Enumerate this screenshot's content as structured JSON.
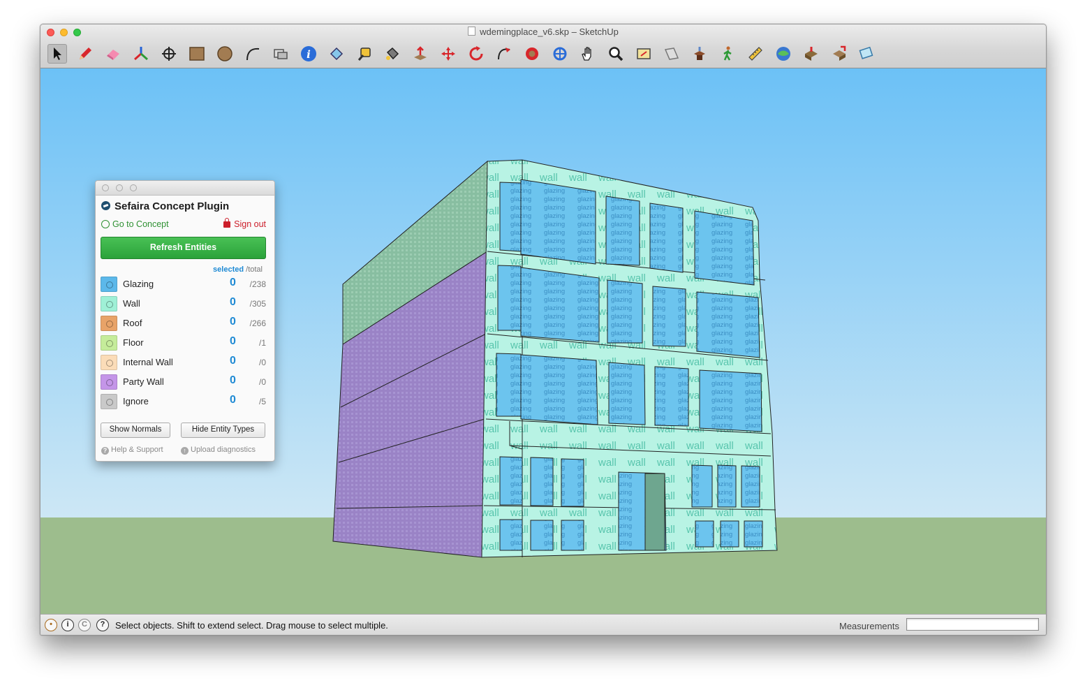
{
  "window": {
    "title": "wdemingplace_v6.skp – SketchUp"
  },
  "toolbar": {
    "tools": [
      {
        "name": "select-tool",
        "icon": "arrow-icon"
      },
      {
        "name": "line-tool",
        "icon": "pencil-icon"
      },
      {
        "name": "eraser-tool",
        "icon": "eraser-icon"
      },
      {
        "name": "axes-tool",
        "icon": "axes-icon"
      },
      {
        "name": "position-camera-tool",
        "icon": "crosshair-icon"
      },
      {
        "name": "rectangle-tool",
        "icon": "rectangle-icon"
      },
      {
        "name": "circle-tool",
        "icon": "circle-icon"
      },
      {
        "name": "arc-tool",
        "icon": "arc-icon"
      },
      {
        "name": "section-plane-tool",
        "icon": "section-icon"
      },
      {
        "name": "model-info-tool",
        "icon": "info-icon"
      },
      {
        "name": "paint-tool",
        "icon": "paint-bucket-icon"
      },
      {
        "name": "tape-measure-tool",
        "icon": "tape-measure-icon"
      },
      {
        "name": "paint-bucket-tool",
        "icon": "bucket-icon"
      },
      {
        "name": "push-pull-tool",
        "icon": "push-pull-icon"
      },
      {
        "name": "move-tool",
        "icon": "move-icon"
      },
      {
        "name": "rotate-tool",
        "icon": "rotate-icon"
      },
      {
        "name": "follow-me-tool",
        "icon": "follow-me-icon"
      },
      {
        "name": "offset-tool",
        "icon": "offset-icon"
      },
      {
        "name": "orbit-tool",
        "icon": "orbit-icon"
      },
      {
        "name": "pan-tool",
        "icon": "hand-icon"
      },
      {
        "name": "zoom-tool",
        "icon": "magnifier-icon"
      },
      {
        "name": "zoom-extents-tool",
        "icon": "zoom-extents-icon"
      },
      {
        "name": "previous-view-tool",
        "icon": "previous-view-icon"
      },
      {
        "name": "get-models-tool",
        "icon": "get-models-icon"
      },
      {
        "name": "walk-tool",
        "icon": "walk-icon"
      },
      {
        "name": "dimension-tool",
        "icon": "ruler-icon"
      },
      {
        "name": "geo-location-tool",
        "icon": "globe-icon"
      },
      {
        "name": "share-model-tool",
        "icon": "share-model-icon"
      },
      {
        "name": "share-component-tool",
        "icon": "share-component-icon"
      },
      {
        "name": "layout-tool",
        "icon": "layout-icon"
      }
    ]
  },
  "plugin": {
    "title": "Sefaira Concept Plugin",
    "goto_label": "Go to Concept",
    "signout_label": "Sign out",
    "refresh_label": "Refresh Entities",
    "col_selected": "selected",
    "col_total": "/total",
    "entities": [
      {
        "name": "Glazing",
        "selected": "0",
        "total": "/238",
        "color": "#5cb8ea"
      },
      {
        "name": "Wall",
        "selected": "0",
        "total": "/305",
        "color": "#9ff0d6"
      },
      {
        "name": "Roof",
        "selected": "0",
        "total": "/266",
        "color": "#e8a368"
      },
      {
        "name": "Floor",
        "selected": "0",
        "total": "/1",
        "color": "#c5ec9a"
      },
      {
        "name": "Internal Wall",
        "selected": "0",
        "total": "/0",
        "color": "#fbdcb8"
      },
      {
        "name": "Party Wall",
        "selected": "0",
        "total": "/0",
        "color": "#c495e8"
      },
      {
        "name": "Ignore",
        "selected": "0",
        "total": "/5",
        "color": "#c9c9c9"
      }
    ],
    "show_normals_label": "Show Normals",
    "hide_entity_types_label": "Hide Entity Types",
    "help_label": "Help & Support",
    "upload_label": "Upload diagnostics"
  },
  "viewport": {
    "sky_color": "#79c6f5",
    "ground_color": "#9dbd8d",
    "wall_color": "#b8f3e4",
    "glazing_color": "#6cc4ee",
    "party_wall_color": "#9a83c6",
    "wall_text": "wall",
    "glazing_text": "glazing"
  },
  "status": {
    "message": "Select objects. Shift to extend select. Drag mouse to select multiple.",
    "measurements_label": "Measurements",
    "measurements_value": ""
  }
}
